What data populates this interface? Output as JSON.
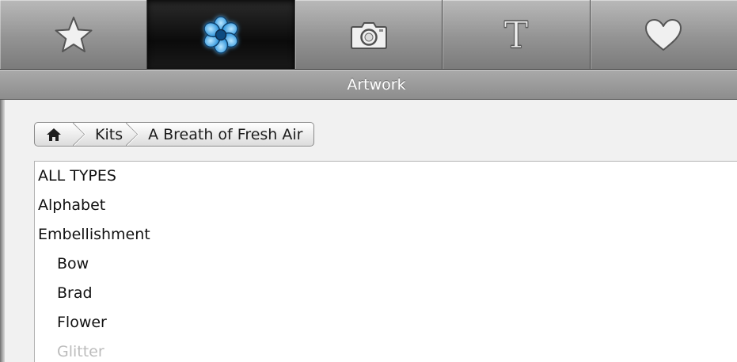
{
  "toolbar": {
    "items": [
      {
        "icon": "star-icon",
        "active": false
      },
      {
        "icon": "flower-icon",
        "active": true,
        "accent": "#3aa7e8"
      },
      {
        "icon": "camera-icon",
        "active": false
      },
      {
        "icon": "text-icon",
        "label": "T",
        "active": false
      },
      {
        "icon": "heart-icon",
        "active": false
      }
    ]
  },
  "header": {
    "title": "Artwork"
  },
  "breadcrumb": {
    "home_icon": "home-icon",
    "items": [
      "Kits",
      "A Breath of Fresh Air"
    ]
  },
  "type_list": {
    "items": [
      {
        "label": "ALL TYPES",
        "level": 0
      },
      {
        "label": "Alphabet",
        "level": 0
      },
      {
        "label": "Embellishment",
        "level": 0
      },
      {
        "label": "Bow",
        "level": 1
      },
      {
        "label": "Brad",
        "level": 1
      },
      {
        "label": "Flower",
        "level": 1
      },
      {
        "label": "Glitter",
        "level": 1
      }
    ]
  }
}
